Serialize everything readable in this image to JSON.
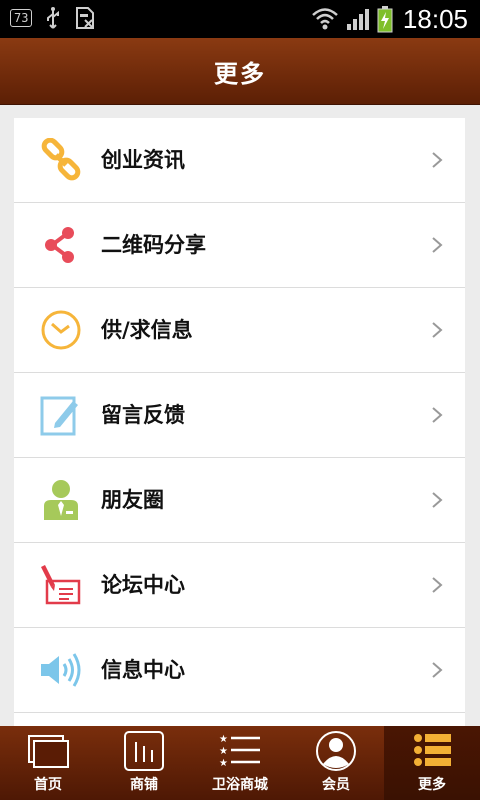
{
  "status_bar": {
    "notification_count": "73",
    "time": "18:05"
  },
  "header": {
    "title": "更多"
  },
  "menu": {
    "items": [
      {
        "label": "创业资讯",
        "icon": "link-icon"
      },
      {
        "label": "二维码分享",
        "icon": "share-icon"
      },
      {
        "label": "供/求信息",
        "icon": "clock-icon"
      },
      {
        "label": "留言反馈",
        "icon": "edit-icon"
      },
      {
        "label": "朋友圈",
        "icon": "user-tie-icon"
      },
      {
        "label": "论坛中心",
        "icon": "pen-paper-icon"
      },
      {
        "label": "信息中心",
        "icon": "speaker-icon"
      }
    ]
  },
  "tabbar": {
    "tabs": [
      {
        "label": "首页",
        "icon": "home-icon"
      },
      {
        "label": "商铺",
        "icon": "shop-icon"
      },
      {
        "label": "卫浴商城",
        "icon": "list-star-icon"
      },
      {
        "label": "会员",
        "icon": "member-icon"
      },
      {
        "label": "更多",
        "icon": "more-list-icon"
      }
    ],
    "active_tab": "更多"
  },
  "colors": {
    "header_bg": "#6e2a0b",
    "tab_active_bg": "#3f1302",
    "link_icon": "#f6b53a",
    "share_icon": "#e84c5a",
    "clock_icon": "#f6b53a",
    "edit_icon": "#8ecbea",
    "user_icon": "#a6c95a",
    "pen_icon": "#e23b4a",
    "speaker_icon": "#7cc6ea",
    "more_icon": "#f3b035"
  }
}
